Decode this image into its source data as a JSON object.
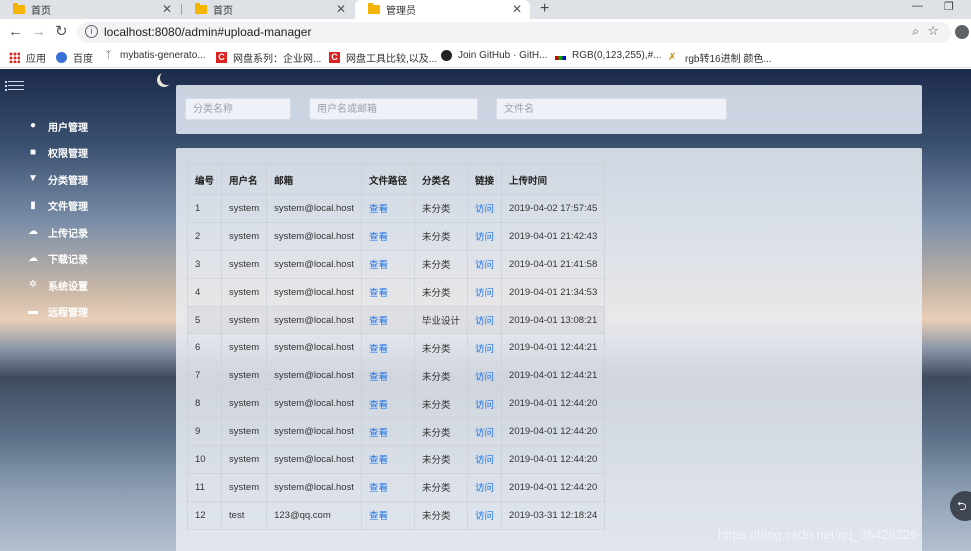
{
  "browser": {
    "tabs": [
      {
        "title": "首页",
        "active": false
      },
      {
        "title": "首页",
        "active": false
      },
      {
        "title": "管理员",
        "active": true
      }
    ],
    "url": "localhost:8080/admin#upload-manager",
    "bookmarks": [
      {
        "label": "应用",
        "icon": "apps-grid-icon"
      },
      {
        "label": "百度",
        "icon": "baidu-paw-icon"
      },
      {
        "label": "mybatis-generato...",
        "icon": "mybatis-icon"
      },
      {
        "label": "网盘系列：企业网...",
        "icon": "csdn-c-icon"
      },
      {
        "label": "网盘工具比较,以及...",
        "icon": "csdn-c-icon"
      },
      {
        "label": "Join GitHub · GitH...",
        "icon": "github-icon"
      },
      {
        "label": "RGB(0,123,255),#...",
        "icon": "rgb-icon"
      },
      {
        "label": "rgb转16进制 颜色...",
        "icon": "tool-icon"
      }
    ]
  },
  "sidebar": {
    "items": [
      {
        "label": "用户管理",
        "icon": "user-icon"
      },
      {
        "label": "权限管理",
        "icon": "lock-icon"
      },
      {
        "label": "分类管理",
        "icon": "filter-icon"
      },
      {
        "label": "文件管理",
        "icon": "file-icon"
      },
      {
        "label": "上传记录",
        "icon": "cloud-upload-icon"
      },
      {
        "label": "下载记录",
        "icon": "cloud-download-icon"
      },
      {
        "label": "系统设置",
        "icon": "gear-icon"
      },
      {
        "label": "远程管理",
        "icon": "folder-icon"
      }
    ]
  },
  "filters": {
    "category_placeholder": "分类名称",
    "user_placeholder": "用户名或邮箱",
    "file_placeholder": "文件名"
  },
  "table": {
    "headers": [
      "编号",
      "用户名",
      "邮箱",
      "文件路径",
      "分类名",
      "链接",
      "上传时间"
    ],
    "rows": [
      {
        "id": "1",
        "user": "system",
        "email": "system@local.host",
        "path": "查看",
        "category": "未分类",
        "link": "访问",
        "time": "2019-04-02 17:57:45"
      },
      {
        "id": "2",
        "user": "system",
        "email": "system@local.host",
        "path": "查看",
        "category": "未分类",
        "link": "访问",
        "time": "2019-04-01 21:42:43"
      },
      {
        "id": "3",
        "user": "system",
        "email": "system@local.host",
        "path": "查看",
        "category": "未分类",
        "link": "访问",
        "time": "2019-04-01 21:41:58"
      },
      {
        "id": "4",
        "user": "system",
        "email": "system@local.host",
        "path": "查看",
        "category": "未分类",
        "link": "访问",
        "time": "2019-04-01 21:34:53"
      },
      {
        "id": "5",
        "user": "system",
        "email": "system@local.host",
        "path": "查看",
        "category": "毕业设计",
        "link": "访问",
        "time": "2019-04-01 13:08:21"
      },
      {
        "id": "6",
        "user": "system",
        "email": "system@local.host",
        "path": "查看",
        "category": "未分类",
        "link": "访问",
        "time": "2019-04-01 12:44:21"
      },
      {
        "id": "7",
        "user": "system",
        "email": "system@local.host",
        "path": "查看",
        "category": "未分类",
        "link": "访问",
        "time": "2019-04-01 12:44:21"
      },
      {
        "id": "8",
        "user": "system",
        "email": "system@local.host",
        "path": "查看",
        "category": "未分类",
        "link": "访问",
        "time": "2019-04-01 12:44:20"
      },
      {
        "id": "9",
        "user": "system",
        "email": "system@local.host",
        "path": "查看",
        "category": "未分类",
        "link": "访问",
        "time": "2019-04-01 12:44:20"
      },
      {
        "id": "10",
        "user": "system",
        "email": "system@local.host",
        "path": "查看",
        "category": "未分类",
        "link": "访问",
        "time": "2019-04-01 12:44:20"
      },
      {
        "id": "11",
        "user": "system",
        "email": "system@local.host",
        "path": "查看",
        "category": "未分类",
        "link": "访问",
        "time": "2019-04-01 12:44:20"
      },
      {
        "id": "12",
        "user": "test",
        "email": "123@qq.com",
        "path": "查看",
        "category": "未分类",
        "link": "访问",
        "time": "2019-03-31 12:18:24"
      }
    ]
  },
  "watermark": "https://blog.csdn.net/qq_36426326",
  "colors": {
    "link": "#1a73e8",
    "folder_tab_icon": "#f5b400"
  }
}
